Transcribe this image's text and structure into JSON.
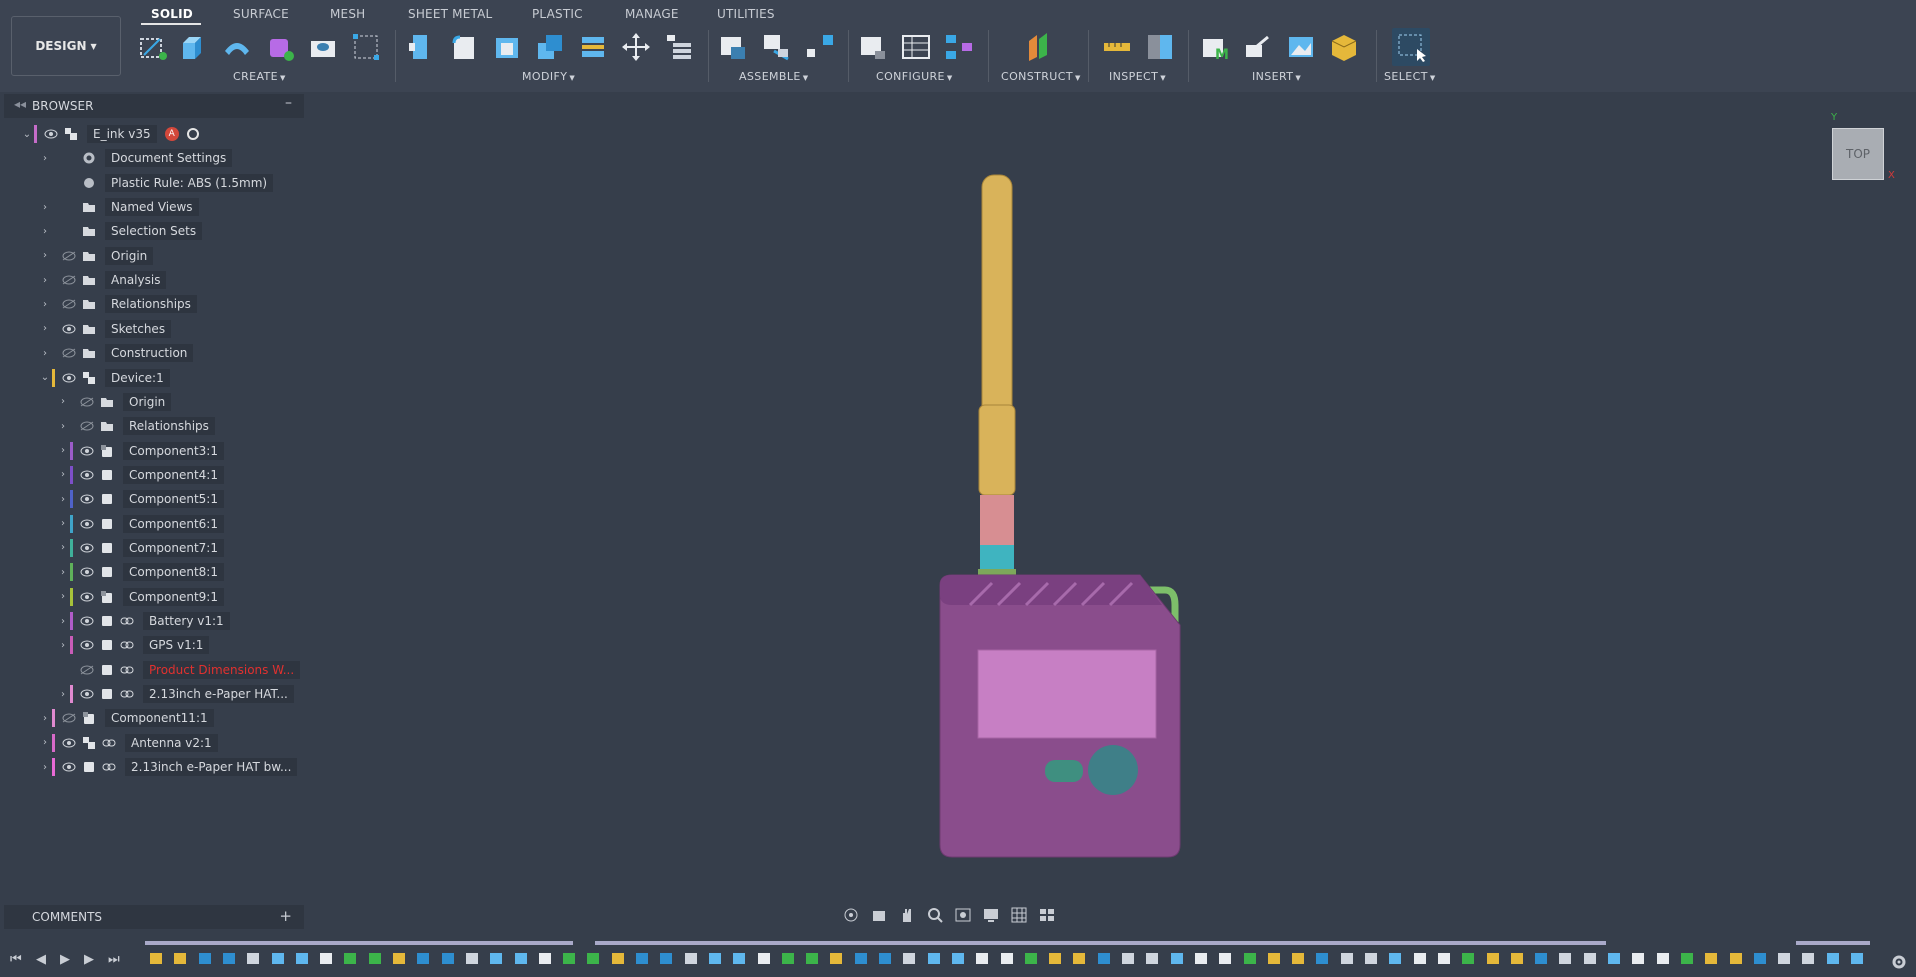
{
  "workspace": {
    "label": "DESIGN"
  },
  "tabs": [
    {
      "label": "SOLID",
      "active": true
    },
    {
      "label": "SURFACE"
    },
    {
      "label": "MESH"
    },
    {
      "label": "SHEET METAL"
    },
    {
      "label": "PLASTIC"
    },
    {
      "label": "MANAGE"
    },
    {
      "label": "UTILITIES"
    }
  ],
  "groups": [
    "CREATE",
    "MODIFY",
    "ASSEMBLE",
    "CONFIGURE",
    "CONSTRUCT",
    "INSPECT",
    "INSERT",
    "SELECT"
  ],
  "browser": {
    "title": "BROWSER",
    "items": [
      {
        "label": "E_ink v35",
        "indent": 0,
        "expanded": true,
        "color": "#c56cc9",
        "eye": "open",
        "icon": "component-root",
        "badges": true
      },
      {
        "label": "Document Settings",
        "indent": 1,
        "icon": "gear"
      },
      {
        "label": "Plastic Rule: ABS (1.5mm)",
        "indent": 1,
        "icon": "plastic-rule",
        "noarrow": true
      },
      {
        "label": "Named Views",
        "indent": 1,
        "icon": "folder"
      },
      {
        "label": "Selection Sets",
        "indent": 1,
        "icon": "folder"
      },
      {
        "label": "Origin",
        "indent": 1,
        "icon": "folder",
        "eye": "hidden"
      },
      {
        "label": "Analysis",
        "indent": 1,
        "icon": "folder",
        "eye": "hidden"
      },
      {
        "label": "Relationships",
        "indent": 1,
        "icon": "folder",
        "eye": "hidden"
      },
      {
        "label": "Sketches",
        "indent": 1,
        "icon": "folder",
        "eye": "open"
      },
      {
        "label": "Construction",
        "indent": 1,
        "icon": "folder",
        "eye": "hidden"
      },
      {
        "label": "Device:1",
        "indent": 1,
        "expanded": true,
        "color": "#e5b83a",
        "eye": "open",
        "icon": "component-root"
      },
      {
        "label": "Origin",
        "indent": 2,
        "icon": "folder",
        "eye": "hidden"
      },
      {
        "label": "Relationships",
        "indent": 2,
        "icon": "folder",
        "eye": "hidden"
      },
      {
        "label": "Component3:1",
        "indent": 2,
        "color": "#9b5cc9",
        "eye": "open",
        "icon": "component-doc"
      },
      {
        "label": "Component4:1",
        "indent": 2,
        "color": "#7d4fc9",
        "eye": "open",
        "icon": "component"
      },
      {
        "label": "Component5:1",
        "indent": 2,
        "color": "#4f62c9",
        "eye": "open",
        "icon": "component"
      },
      {
        "label": "Component6:1",
        "indent": 2,
        "color": "#3fa4c9",
        "eye": "open",
        "icon": "component"
      },
      {
        "label": "Component7:1",
        "indent": 2,
        "color": "#3fb09a",
        "eye": "open",
        "icon": "component"
      },
      {
        "label": "Component8:1",
        "indent": 2,
        "color": "#5fb05a",
        "eye": "open",
        "icon": "component"
      },
      {
        "label": "Component9:1",
        "indent": 2,
        "color": "#a6c23a",
        "eye": "open",
        "icon": "component-doc"
      },
      {
        "label": "Battery v1:1",
        "indent": 2,
        "color": "#b05cc9",
        "eye": "open",
        "icon": "component",
        "link": true
      },
      {
        "label": "GPS v1:1",
        "indent": 2,
        "color": "#c95cb8",
        "eye": "open",
        "icon": "component",
        "link": true
      },
      {
        "label": "Product Dimensions W...",
        "indent": 2,
        "eye": "hidden",
        "icon": "component",
        "link": true,
        "red": true,
        "noarrow": true
      },
      {
        "label": "2.13inch e-Paper HAT...",
        "indent": 2,
        "color": "#e08ad0",
        "eye": "open",
        "icon": "component",
        "link": true
      },
      {
        "label": "Component11:1",
        "indent": 1,
        "color": "#e08ad0",
        "eye": "hidden",
        "icon": "component-doc"
      },
      {
        "label": "Antenna v2:1",
        "indent": 1,
        "color": "#d86ac9",
        "eye": "open",
        "icon": "component-root",
        "link": true
      },
      {
        "label": "2.13inch e-Paper HAT bw...",
        "indent": 1,
        "color": "#e86ad6",
        "eye": "open",
        "icon": "component",
        "link": true
      }
    ]
  },
  "comments": {
    "title": "COMMENTS"
  },
  "viewcube": {
    "face": "TOP",
    "x_axis": "X",
    "y_axis": "Y"
  },
  "colors": {
    "background": "#363e4b",
    "antenna": "#d9b35a",
    "body": "#8a4d8c",
    "screen": "#c77fc4",
    "button": "#3f7f88",
    "accent_red": "#e0312f"
  }
}
